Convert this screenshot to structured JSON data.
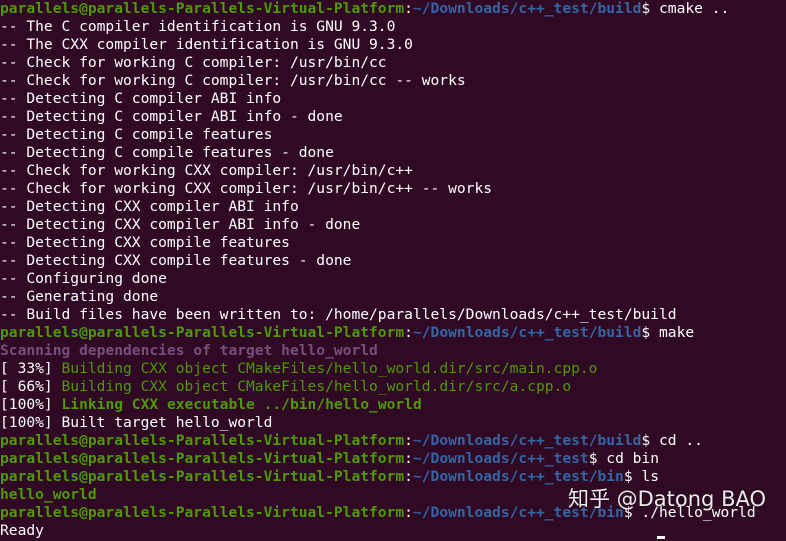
{
  "colors": {
    "background": "#300a24",
    "prompt_user": "#4e9a06",
    "prompt_path": "#3465a4",
    "text": "#ffffff",
    "scan": "#75507b",
    "build_green": "#4e9a06"
  },
  "prompt": {
    "user_host": "parallels@parallels-Parallels-Virtual-Platform",
    "colon": ":",
    "dollar": "$"
  },
  "paths": {
    "build": "~/Downloads/c++_test/build",
    "test": "~/Downloads/c++_test",
    "bin": "~/Downloads/c++_test/bin"
  },
  "commands": {
    "cmake": " cmake ..",
    "make": " make",
    "cd_up": " cd ..",
    "cd_bin": " cd bin",
    "ls": " ls",
    "run": " ./hello_world"
  },
  "cmake_output": [
    "-- The C compiler identification is GNU 9.3.0",
    "-- The CXX compiler identification is GNU 9.3.0",
    "-- Check for working C compiler: /usr/bin/cc",
    "-- Check for working C compiler: /usr/bin/cc -- works",
    "-- Detecting C compiler ABI info",
    "-- Detecting C compiler ABI info - done",
    "-- Detecting C compile features",
    "-- Detecting C compile features - done",
    "-- Check for working CXX compiler: /usr/bin/c++",
    "-- Check for working CXX compiler: /usr/bin/c++ -- works",
    "-- Detecting CXX compiler ABI info",
    "-- Detecting CXX compiler ABI info - done",
    "-- Detecting CXX compile features",
    "-- Detecting CXX compile features - done",
    "-- Configuring done",
    "-- Generating done",
    "-- Build files have been written to: /home/parallels/Downloads/c++_test/build"
  ],
  "make_output": {
    "scanning": "Scanning dependencies of target hello_world",
    "build1_pct": "[ 33%] ",
    "build1_text": "Building CXX object CMakeFiles/hello_world.dir/src/main.cpp.o",
    "build2_pct": "[ 66%] ",
    "build2_text": "Building CXX object CMakeFiles/hello_world.dir/src/a.cpp.o",
    "link_pct": "[100%] ",
    "link_text": "Linking CXX executable ../bin/hello_world",
    "built": "[100%] Built target hello_world"
  },
  "ls_output": "hello_world",
  "run_output": "Ready",
  "watermark": "知乎 @Datong BAO"
}
